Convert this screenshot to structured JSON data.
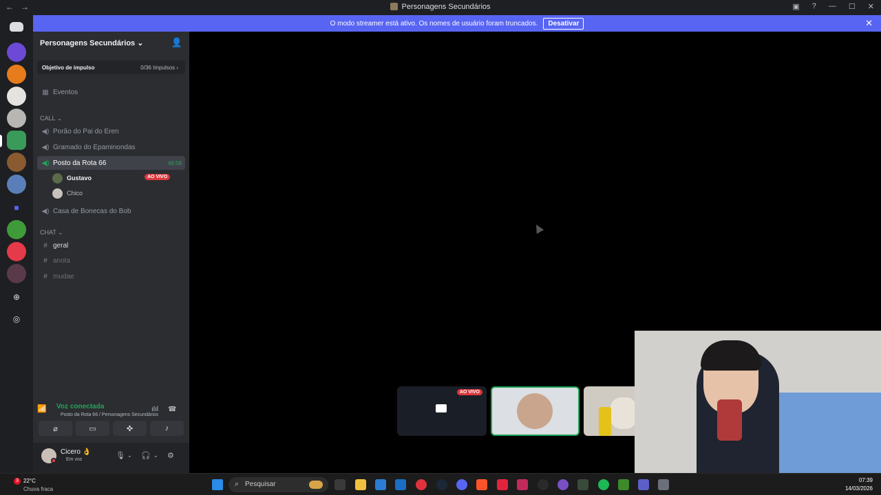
{
  "window": {
    "title": "Personagens Secundários"
  },
  "banner": {
    "text": "O modo streamer está ativo. Os nomes de usuário foram truncados.",
    "button": "Desativar"
  },
  "server": {
    "name": "Personagens Secundários",
    "boost_label": "Objetivo de impulso",
    "boost_count": "0/36 Impulsos",
    "events": "Eventos",
    "categories": {
      "call": "CALL",
      "chat": "CHAT"
    },
    "voice_channels": [
      {
        "name": "Porão do Pai do Eren"
      },
      {
        "name": "Gramado do Epaminondas"
      },
      {
        "name": "Posto da Rota 66",
        "timer": "46:58"
      },
      {
        "name": "Casa de Bonecas do Bob"
      }
    ],
    "voice_users": [
      {
        "name": "Gustavo",
        "badge": "AO VIVO"
      },
      {
        "name": "Chico"
      }
    ],
    "text_channels": [
      {
        "name": "geral"
      },
      {
        "name": "anota"
      },
      {
        "name": "mudae"
      }
    ]
  },
  "voice_connection": {
    "status": "Voz conectada",
    "location": "Posto da Rota 66 / Personagens Secundários"
  },
  "user_panel": {
    "name": "Cicero 👌",
    "status": "Em voz"
  },
  "stream_tiles": {
    "live_badge": "AO VIVO"
  },
  "taskbar": {
    "temperature": "22°C",
    "weather": "Chuva fraca",
    "weather_badge": "3",
    "search_placeholder": "Pesquisar",
    "time": "07:39",
    "date": "14/03/2026"
  },
  "colors": {
    "accent": "#5865f2",
    "online": "#23a559",
    "live": "#da373c"
  }
}
